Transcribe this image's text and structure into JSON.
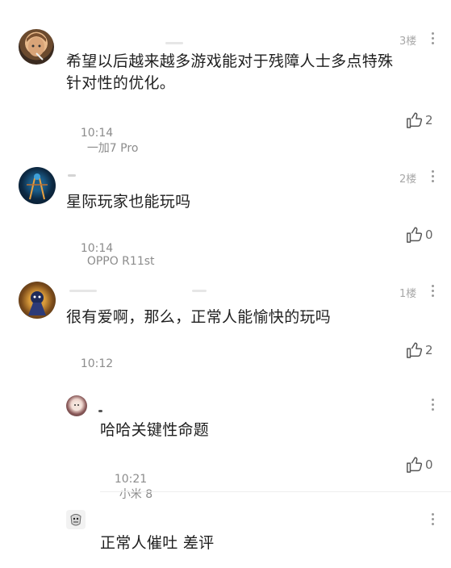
{
  "comments": [
    {
      "floor": "3楼",
      "text_line1": "希望以后越来越多游戏能对于残障人士多点特殊",
      "text_line2": "针对性的优化。",
      "time": "10:14",
      "device": "一加7 Pro",
      "likes": "2"
    },
    {
      "floor": "2楼",
      "text": "星际玩家也能玩吗",
      "time": "10:14",
      "device": "OPPO R11st",
      "likes": "0"
    },
    {
      "floor": "1楼",
      "text": "很有爱啊，那么，正常人能愉快的玩吗",
      "time": "10:12",
      "device": "",
      "likes": "2"
    }
  ],
  "replies": [
    {
      "text": "哈哈关键性命题",
      "time": "10:21",
      "device": "小米 8",
      "likes": "0"
    },
    {
      "text": "正常人催吐 差评"
    }
  ],
  "icons": {
    "like": "thumbs-up-icon",
    "more": "more-vertical-icon"
  }
}
